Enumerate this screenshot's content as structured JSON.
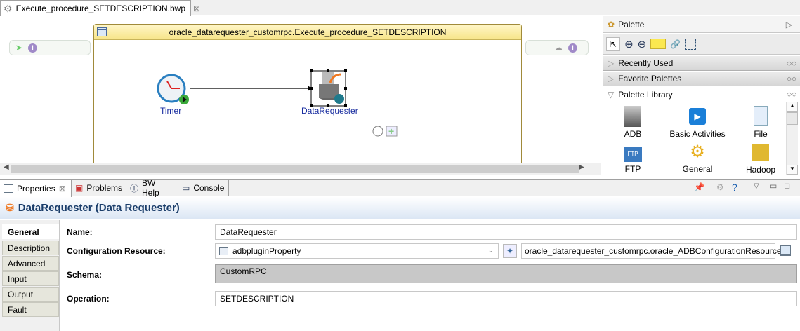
{
  "editor": {
    "tab_title": "Execute_procedure_SETDESCRIPTION.bwp",
    "process_title": "oracle_datarequester_customrpc.Execute_procedure_SETDESCRIPTION",
    "nodes": {
      "timer": "Timer",
      "datarequester": "DataRequester"
    }
  },
  "palette": {
    "title": "Palette",
    "drawers": [
      "Recently Used",
      "Favorite Palettes",
      "Palette Library"
    ],
    "items": [
      "ADB",
      "Basic Activities",
      "File",
      "FTP",
      "General",
      "Hadoop"
    ]
  },
  "bottom": {
    "tabs": [
      "Properties",
      "Problems",
      "BW Help",
      "Console"
    ],
    "title": "DataRequester (Data Requester)",
    "side_tabs": [
      "General",
      "Description",
      "Advanced",
      "Input",
      "Output",
      "Fault"
    ],
    "fields": {
      "name_label": "Name:",
      "name_value": "DataRequester",
      "config_label": "Configuration Resource:",
      "config_value": "adbpluginProperty",
      "config_resource": "oracle_datarequester_customrpc.oracle_ADBConfigurationResource",
      "schema_label": "Schema:",
      "schema_value": "CustomRPC",
      "operation_label": "Operation:",
      "operation_value": "SETDESCRIPTION"
    }
  },
  "colors": {
    "accent": "#1a3d6a",
    "process_header": "#f7e58a"
  }
}
